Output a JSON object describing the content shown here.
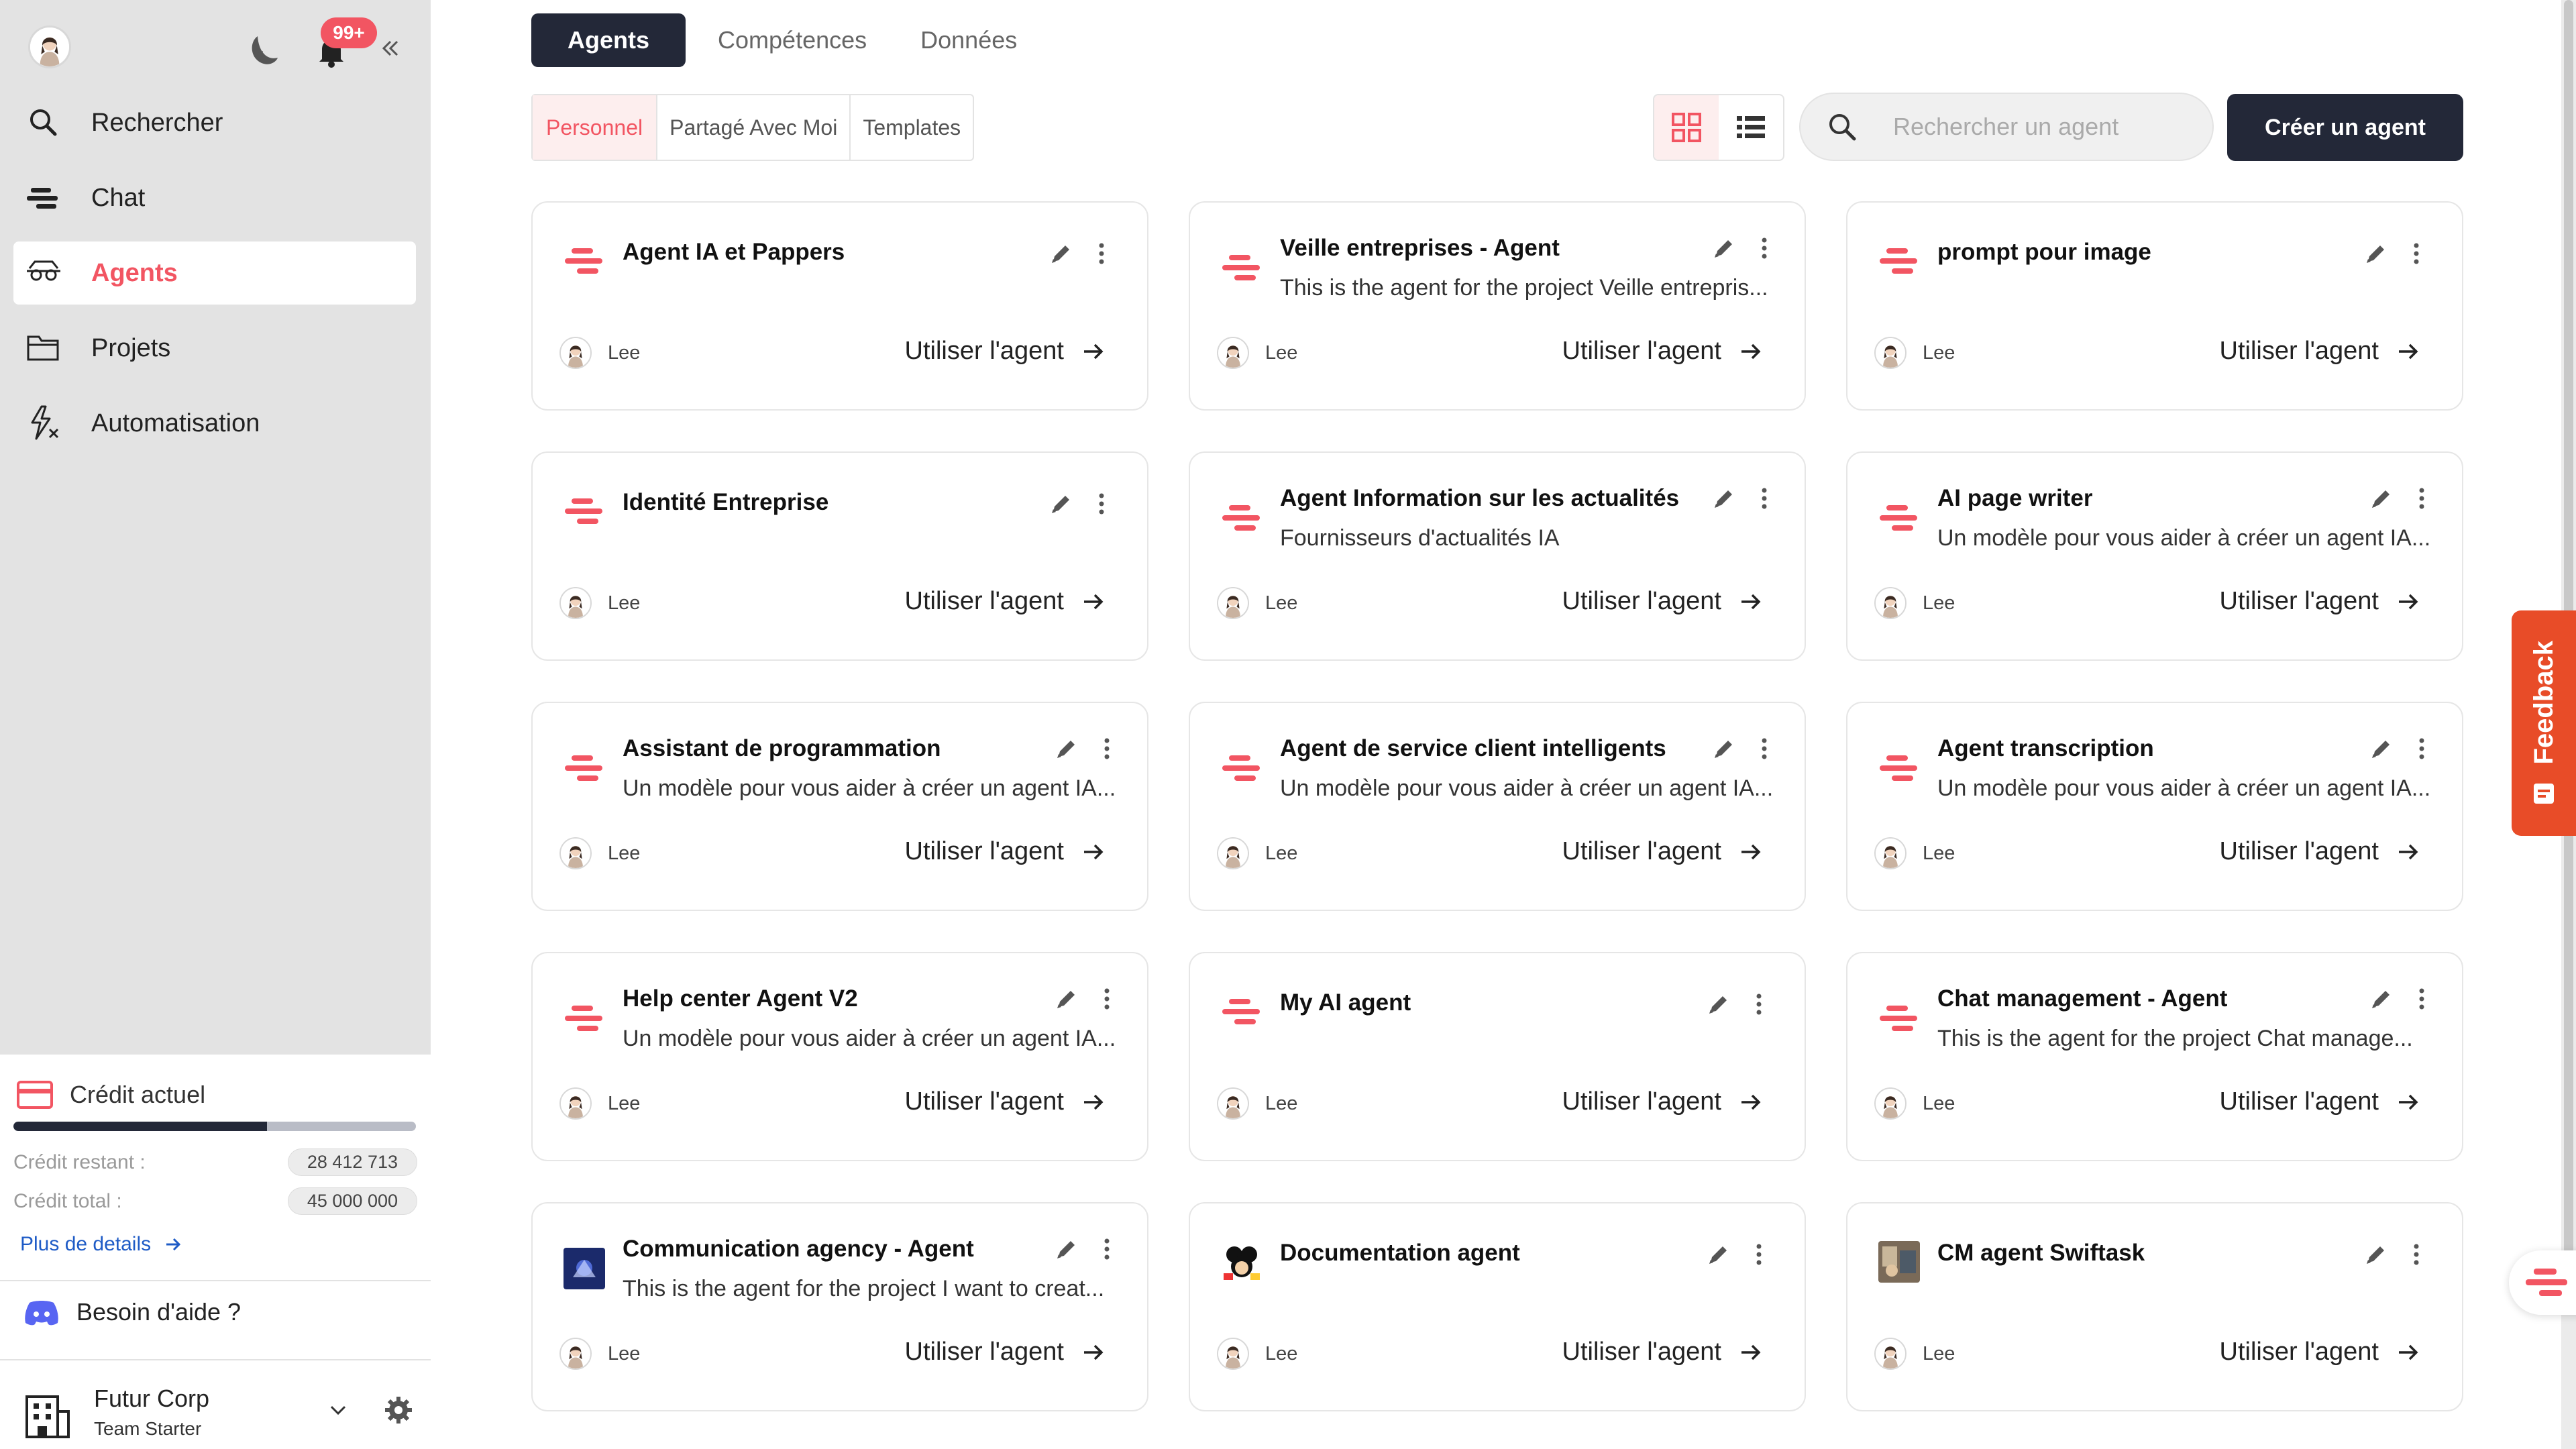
{
  "sidebar": {
    "notification_count": "99+",
    "nav": [
      {
        "label": "Rechercher",
        "icon": "search-icon"
      },
      {
        "label": "Chat",
        "icon": "chat-icon"
      },
      {
        "label": "Agents",
        "icon": "agent-icon",
        "active": true
      },
      {
        "label": "Projets",
        "icon": "folder-icon"
      },
      {
        "label": "Automatisation",
        "icon": "automation-icon"
      }
    ],
    "credit": {
      "title": "Crédit actuel",
      "remaining_label": "Crédit restant :",
      "remaining_value": "28 412 713",
      "total_label": "Crédit total :",
      "total_value": "45 000 000",
      "used_fraction": 0.63,
      "more_label": "Plus de details"
    },
    "help_label": "Besoin d'aide ?",
    "org": {
      "name": "Futur Corp",
      "plan": "Team Starter"
    }
  },
  "tabs": [
    "Agents",
    "Compétences",
    "Données"
  ],
  "subtabs": [
    "Personnel",
    "Partagé Avec Moi",
    "Templates"
  ],
  "search": {
    "placeholder": "Rechercher un agent"
  },
  "create_button": "Créer un agent",
  "cards": [
    {
      "title": "Agent IA et Pappers",
      "desc": "",
      "user": "Lee",
      "action": "Utiliser l'agent",
      "logo": "brand"
    },
    {
      "title": "Veille entreprises - Agent",
      "desc": "This is the agent for the project Veille entrepris...",
      "user": "Lee",
      "action": "Utiliser l'agent",
      "logo": "brand"
    },
    {
      "title": "prompt pour image",
      "desc": "",
      "user": "Lee",
      "action": "Utiliser l'agent",
      "logo": "brand"
    },
    {
      "title": "Identité Entreprise",
      "desc": "",
      "user": "Lee",
      "action": "Utiliser l'agent",
      "logo": "brand"
    },
    {
      "title": "Agent Information sur les actualités",
      "desc": "Fournisseurs d'actualités IA",
      "user": "Lee",
      "action": "Utiliser l'agent",
      "logo": "brand"
    },
    {
      "title": "AI page writer",
      "desc": "Un modèle pour vous aider à créer un agent IA...",
      "user": "Lee",
      "action": "Utiliser l'agent",
      "logo": "brand"
    },
    {
      "title": "Assistant de programmation",
      "desc": "Un modèle pour vous aider à créer un agent IA...",
      "user": "Lee",
      "action": "Utiliser l'agent",
      "logo": "brand"
    },
    {
      "title": "Agent de service client intelligents",
      "desc": "Un modèle pour vous aider à créer un agent IA...",
      "user": "Lee",
      "action": "Utiliser l'agent",
      "logo": "brand"
    },
    {
      "title": "Agent transcription",
      "desc": "Un modèle pour vous aider à créer un agent IA...",
      "user": "Lee",
      "action": "Utiliser l'agent",
      "logo": "brand"
    },
    {
      "title": "Help center Agent V2",
      "desc": "Un modèle pour vous aider à créer un agent IA...",
      "user": "Lee",
      "action": "Utiliser l'agent",
      "logo": "brand"
    },
    {
      "title": "My AI agent",
      "desc": "",
      "user": "Lee",
      "action": "Utiliser l'agent",
      "logo": "brand"
    },
    {
      "title": "Chat management - Agent",
      "desc": "This is the agent for the project Chat manage...",
      "user": "Lee",
      "action": "Utiliser l'agent",
      "logo": "brand"
    },
    {
      "title": "Communication agency - Agent",
      "desc": "This is the agent for the project I want to creat...",
      "user": "Lee",
      "action": "Utiliser l'agent",
      "logo": "image-blue"
    },
    {
      "title": "Documentation agent",
      "desc": "",
      "user": "Lee",
      "action": "Utiliser l'agent",
      "logo": "image-cartoon"
    },
    {
      "title": "CM agent Swiftask",
      "desc": "",
      "user": "Lee",
      "action": "Utiliser l'agent",
      "logo": "image-photo"
    }
  ],
  "feedback_label": "Feedback",
  "colors": {
    "accent": "#f25562",
    "dark": "#232838",
    "feedback": "#e84c28",
    "link": "#1e5bc6"
  }
}
